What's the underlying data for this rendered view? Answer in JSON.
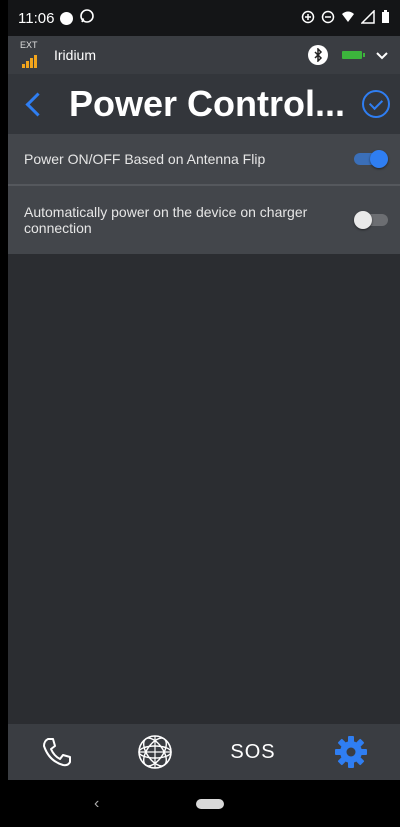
{
  "status_bar": {
    "time": "11:06",
    "icons": [
      "notification-dot-icon",
      "whatsapp-icon",
      "data-saver-icon",
      "do-not-disturb-icon",
      "wifi-icon",
      "signal-icon",
      "battery-icon"
    ]
  },
  "connection": {
    "ext_label": "EXT",
    "network_name": "Iridium",
    "icons": [
      "signal-bars-icon",
      "bluetooth-icon",
      "battery-icon",
      "chevron-down-icon"
    ],
    "colors": {
      "signal": "#f2a51c",
      "battery": "#3cb43c"
    }
  },
  "header": {
    "title": "Power Control...",
    "icons": [
      "back-chevron-icon",
      "check-circle-icon"
    ],
    "accent_color": "#2f7ef2"
  },
  "settings": [
    {
      "label": "Power ON/OFF Based on Antenna Flip",
      "enabled": true
    },
    {
      "label": "Automatically power on the device on charger connection",
      "enabled": false
    }
  ],
  "tabs": [
    {
      "icon": "phone-icon",
      "label": ""
    },
    {
      "icon": "globe-icon",
      "label": ""
    },
    {
      "icon": "sos-icon",
      "label": "SOS"
    },
    {
      "icon": "gear-icon",
      "label": "",
      "active": true
    }
  ],
  "nav": {
    "back_glyph": "‹"
  }
}
